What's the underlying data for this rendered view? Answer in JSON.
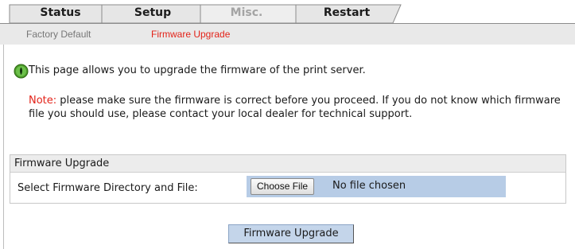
{
  "tabs": [
    {
      "label": "Status",
      "state": "normal"
    },
    {
      "label": "Setup",
      "state": "normal"
    },
    {
      "label": "Misc.",
      "state": "disabled"
    },
    {
      "label": "Restart",
      "state": "normal"
    }
  ],
  "subnav": {
    "items": [
      {
        "label": "Factory Default",
        "active": false
      },
      {
        "label": "Firmware Upgrade",
        "active": true
      }
    ]
  },
  "info": {
    "icon": "info-icon",
    "text": "This page allows you to upgrade the firmware of the print server."
  },
  "note": {
    "label": "Note:",
    "text": " please make sure the firmware is correct before you proceed. If you do not know which firmware file you should use, please contact your local dealer for technical support."
  },
  "firmware_box": {
    "heading": "Firmware Upgrade",
    "field_label": "Select Firmware Directory and File:",
    "choose_button": "Choose File",
    "file_status": "No file chosen"
  },
  "submit_button": "Firmware Upgrade",
  "colors": {
    "accent_red": "#e32319",
    "tab_fill": "#e8e8e8",
    "field_blue": "#b7cce6",
    "button_blue": "#c4d5ea"
  }
}
